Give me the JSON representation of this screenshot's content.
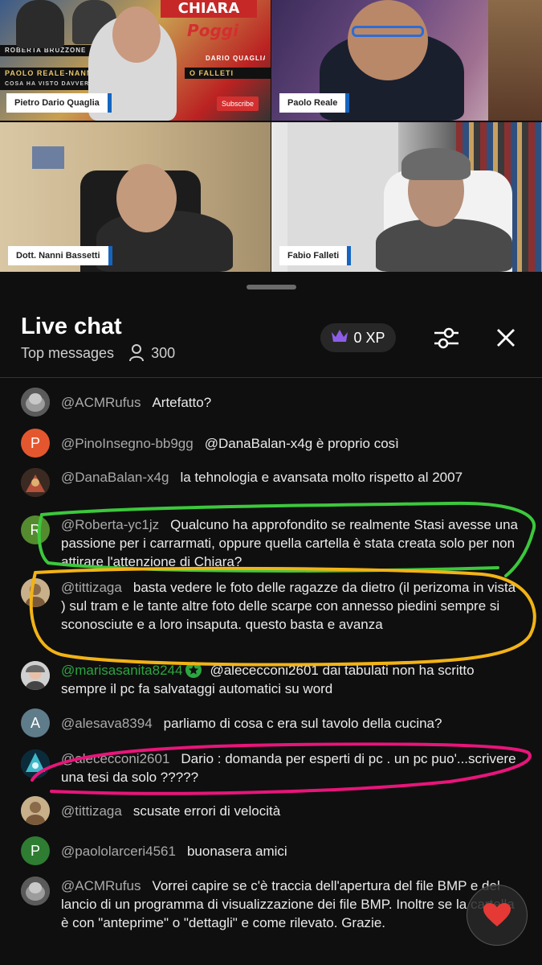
{
  "video": {
    "tiles": [
      {
        "name": "Pietro Dario Quaglia",
        "poster_title": "CHIARA",
        "poster_sub": "Poggi",
        "strip1": "PAOLO REALE-NANNI",
        "strip2": "COSA HA VISTO DAVVERO",
        "strip3": "ROBERTA BRUZZONE",
        "strip4": "DARIO QUAGLIA",
        "poster_right": "O FALLETI",
        "subscribe": "Subscribe"
      },
      {
        "name": "Paolo Reale"
      },
      {
        "name": "Dott. Nanni Bassetti"
      },
      {
        "name": "Fabio Falleti"
      }
    ]
  },
  "header": {
    "title": "Live chat",
    "mode": "Top messages",
    "viewers": "300",
    "xp": "0 XP"
  },
  "messages": [
    {
      "author": "@ACMRufus",
      "text": "Artefatto?",
      "avatar": "photo",
      "avatar_color": "#6d6d6d"
    },
    {
      "author": "@PinoInsegno-bb9gg",
      "text": "@DanaBalan-x4g è proprio così",
      "avatar": "P",
      "avatar_color": "#e4572e"
    },
    {
      "author": "@DanaBalan-x4g",
      "text": "la tehnologia e avansata molto rispetto al 2007",
      "avatar": "photo",
      "avatar_color": "#7a3b2b"
    },
    {
      "author": "@Roberta-yc1jz",
      "text": "Qualcuno ha approfondito se realmente Stasi avesse una passione per i carrarmati, oppure quella cartella è stata creata solo per non attirare l'attenzione di Chiara?",
      "avatar": "R",
      "avatar_color": "#558b2f"
    },
    {
      "author": "@tittizaga",
      "text": "basta vedere le foto delle ragazze da dietro (il perizoma in vista ) sul tram e le tante altre foto delle scarpe con annesso piedini sempre si sconosciute e a loro insaputa. questo basta e avanza",
      "avatar": "photo",
      "avatar_color": "#a08560"
    },
    {
      "author": "@marisasanita8244",
      "text": "@alececconi2601 dai tabulati non ha scritto sempre il pc fa salvataggi automatici su word",
      "avatar": "photo",
      "avatar_color": "#8c8c8c",
      "member": true
    },
    {
      "author": "@alesava8394",
      "text": "parliamo di cosa c era sul tavolo della cucina?",
      "avatar": "A",
      "avatar_color": "#5f7c8a"
    },
    {
      "author": "@alececconi2601",
      "text": "Dario : domanda per esperti di pc . un pc puo'...scrivere una tesi da solo ?????",
      "avatar": "photo",
      "avatar_color": "#1f6f8b"
    },
    {
      "author": "@tittizaga",
      "text": "scusate errori di velocità",
      "avatar": "photo",
      "avatar_color": "#a08560"
    },
    {
      "author": "@paololarceri4561",
      "text": "buonasera amici",
      "avatar": "P",
      "avatar_color": "#2e7d32"
    },
    {
      "author": "@ACMRufus",
      "text": "Vorrei capire se c'è traccia dell'apertura del file BMP e del lancio di un programma di visualizzazione dei file BMP. Inoltre se la cartella è con \"anteprime\" o \"dettagli\" e come rilevato. Grazie.",
      "avatar": "photo",
      "avatar_color": "#6d6d6d"
    }
  ],
  "colors": {
    "annot_green": "#3cc83c",
    "annot_yellow": "#f2b316",
    "annot_pink": "#e8157a",
    "heart": "#e53935"
  }
}
